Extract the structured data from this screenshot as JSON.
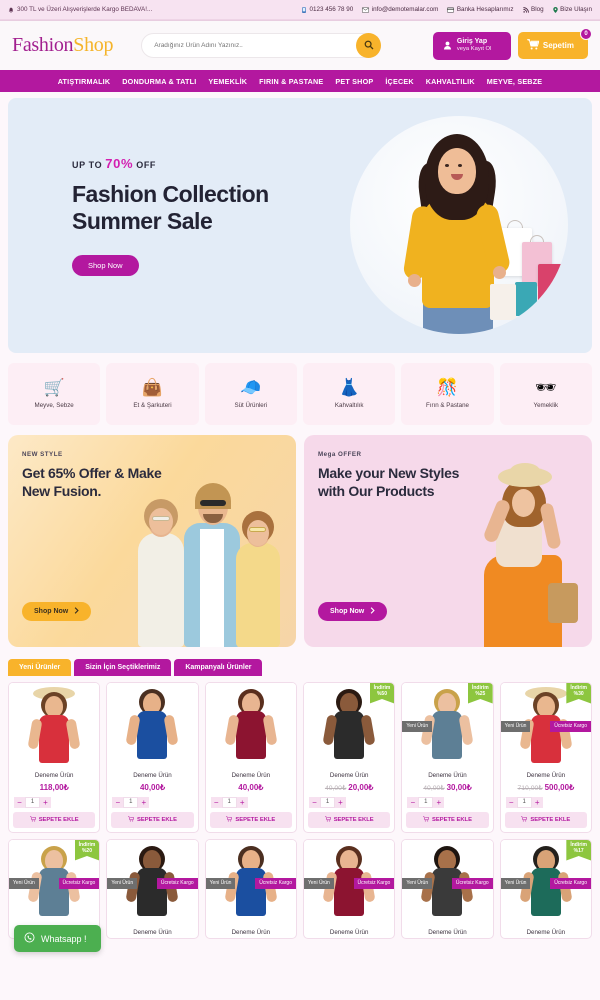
{
  "topbar": {
    "announcement": "300 TL ve Üzeri Alışverişlerde Kargo BEDAVA!...",
    "phone": "0123 456 78 90",
    "email": "info@demotemalar.com",
    "bank": "Banka Hesaplarımız",
    "blog": "Blog",
    "contact": "Bize Ulaşın"
  },
  "header": {
    "logo_part1": "Fashion",
    "logo_part2": "Shop",
    "search_placeholder": "Aradığınız Ürün Adını Yazınız..",
    "search_value": "",
    "login_label": "Giriş Yap",
    "login_sub": "veya Kayıt Ol",
    "cart_label": "Sepetim",
    "cart_count": "0"
  },
  "nav": {
    "items": [
      "ATIŞTIRMALIK",
      "DONDURMA & TATLI",
      "YEMEKLİK",
      "FIRIN & PASTANE",
      "PET SHOP",
      "İÇECEK",
      "KAHVALTILIK",
      "MEYVE, SEBZE"
    ]
  },
  "hero": {
    "kicker_pre": "UP TO",
    "kicker_pct": "70%",
    "kicker_post": "OFF",
    "title_line1": "Fashion Collection",
    "title_line2": "Summer Sale",
    "button": "Shop Now"
  },
  "categories": [
    {
      "label": "Meyve, Sebze",
      "icon": "🛒"
    },
    {
      "label": "Et & Şarkuteri",
      "icon": "👜"
    },
    {
      "label": "Süt Ürünleri",
      "icon": "🧢"
    },
    {
      "label": "Kahvaltılık",
      "icon": "👗"
    },
    {
      "label": "Fırın & Pastane",
      "icon": "🎊"
    },
    {
      "label": "Yemeklik",
      "icon": "🕶"
    }
  ],
  "promos": [
    {
      "kicker": "NEW STYLE",
      "title": "Get 65% Offer & Make New Fusion.",
      "button": "Shop Now"
    },
    {
      "kicker": "Mega OFFER",
      "title": "Make your New Styles with Our Products",
      "button": "Shop Now"
    }
  ],
  "tabs": [
    {
      "label": "Yeni Ürünler",
      "active": true
    },
    {
      "label": "Sizin İçin Seçtiklerimiz",
      "active": false
    },
    {
      "label": "Kampanyalı Ürünler",
      "active": false
    }
  ],
  "product_labels": {
    "add_to_cart": "SEPETE EKLE",
    "qty": "1",
    "minus": "−",
    "plus": "+",
    "new_badge": "Yeni Ürün",
    "free_shipping_badge": "Ücretsiz Kargo",
    "discount_prefix": "İndirim"
  },
  "products_row1": [
    {
      "title": "Deneme Ürün",
      "price": "118,00₺",
      "old_price": "",
      "discount": "",
      "new": false,
      "free_shipping": false
    },
    {
      "title": "Deneme Ürün",
      "price": "40,00₺",
      "old_price": "",
      "discount": "",
      "new": false,
      "free_shipping": false
    },
    {
      "title": "Deneme Ürün",
      "price": "40,00₺",
      "old_price": "",
      "discount": "",
      "new": false,
      "free_shipping": false
    },
    {
      "title": "Deneme Ürün",
      "price": "20,00₺",
      "old_price": "40,00₺",
      "discount": "%50",
      "new": false,
      "free_shipping": false
    },
    {
      "title": "Deneme Ürün",
      "price": "30,00₺",
      "old_price": "40,00₺",
      "discount": "%25",
      "new": true,
      "free_shipping": false
    },
    {
      "title": "Deneme Ürün",
      "price": "500,00₺",
      "old_price": "710,00₺",
      "discount": "%30",
      "new": true,
      "free_shipping": true
    }
  ],
  "products_row2": [
    {
      "title": "Deneme Ürün",
      "discount": "%20",
      "new": true,
      "free_shipping": true
    },
    {
      "title": "Deneme Ürün",
      "discount": "",
      "new": true,
      "free_shipping": true
    },
    {
      "title": "Deneme Ürün",
      "discount": "",
      "new": true,
      "free_shipping": true
    },
    {
      "title": "Deneme Ürün",
      "discount": "",
      "new": true,
      "free_shipping": true
    },
    {
      "title": "Deneme Ürün",
      "discount": "",
      "new": true,
      "free_shipping": true
    },
    {
      "title": "Deneme Ürün",
      "discount": "%17",
      "new": true,
      "free_shipping": true
    }
  ],
  "whatsapp": {
    "label": "Whatsapp !"
  },
  "colors": {
    "brand_purple": "#b3189f",
    "brand_orange": "#f8b32b",
    "accent_pink": "#d31fb0",
    "discount_green": "#8dc63f",
    "whatsapp_green": "#4caf50"
  }
}
